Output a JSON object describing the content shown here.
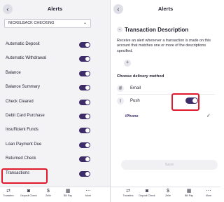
{
  "left": {
    "title": "Alerts",
    "back_icon": "chevron-left-icon",
    "account_select": {
      "value": "NICKELBACK CHECKING",
      "chevron_icon": "chevron-down-icon"
    },
    "alert_rows": [
      {
        "label": "Automatic Deposit",
        "enabled": true
      },
      {
        "label": "Automatic Withdrawal",
        "enabled": true
      },
      {
        "label": "Balance",
        "enabled": true
      },
      {
        "label": "Balance Summary",
        "enabled": true
      },
      {
        "label": "Check Cleared",
        "enabled": true
      },
      {
        "label": "Debit Card Purchase",
        "enabled": true
      },
      {
        "label": "Insufficient Funds",
        "enabled": true
      },
      {
        "label": "Loan Payment Due",
        "enabled": true
      },
      {
        "label": "Returned Check",
        "enabled": true
      },
      {
        "label": "Transactions",
        "enabled": true
      }
    ]
  },
  "right": {
    "title": "Alerts",
    "back_icon": "chevron-left-icon",
    "section_title": "Transaction Description",
    "description": "Receive an alert whenever a transaction is made on this account that matches one or more of the descriptions specified.",
    "delivery_heading": "Choose delivery method",
    "email_label": "Email",
    "push_label": "Push",
    "push_enabled": true,
    "device_name": "iPhone",
    "save_label": "Save"
  },
  "tabbar": [
    {
      "label": "Transfers",
      "icon": "transfer-icon",
      "glyph": "⇄"
    },
    {
      "label": "Deposit Check",
      "icon": "camera-icon",
      "glyph": "◙"
    },
    {
      "label": "Zelle",
      "icon": "zelle-icon",
      "glyph": "$"
    },
    {
      "label": "Bill Pay",
      "icon": "calendar-icon",
      "glyph": "▦"
    },
    {
      "label": "More",
      "icon": "more-icon",
      "glyph": "⋯"
    }
  ],
  "colors": {
    "accent": "#3d2c68",
    "highlight": "#e0192c"
  }
}
